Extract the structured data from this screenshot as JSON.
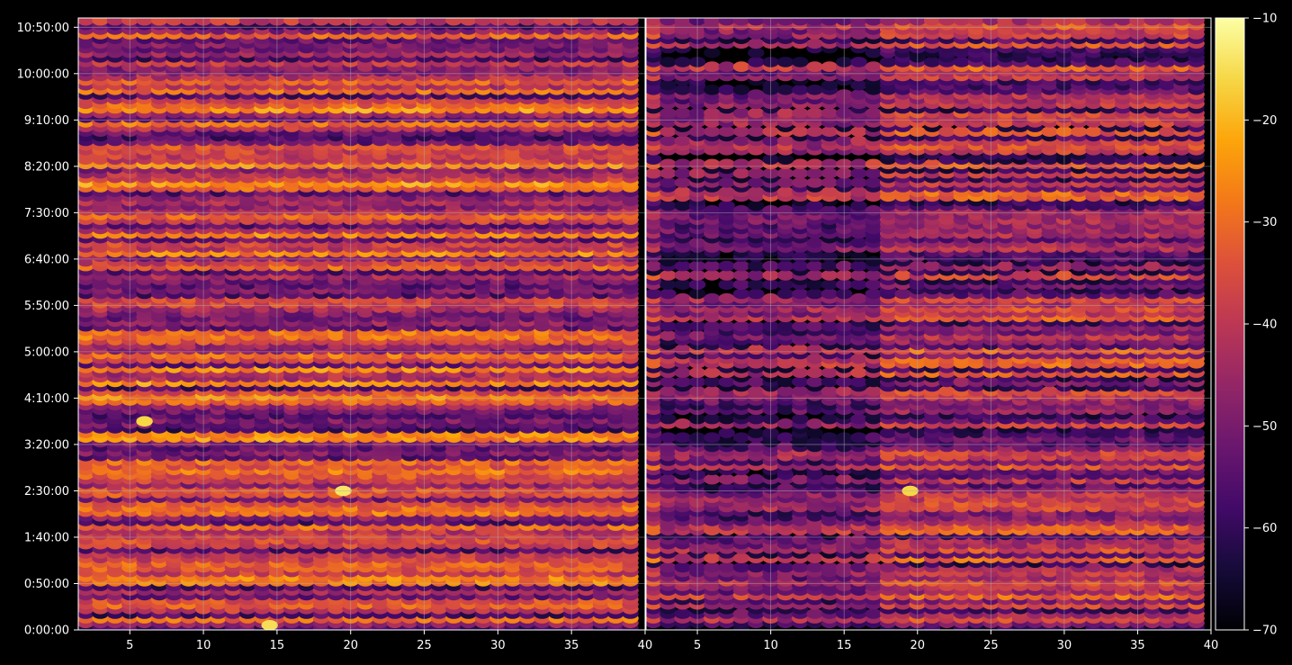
{
  "chart_data": {
    "type": "heatmap",
    "panels": [
      {
        "name": "",
        "xlim": [
          1.5,
          40
        ],
        "x_ticks": [
          5,
          10,
          15,
          20,
          25,
          30,
          35,
          40
        ],
        "x_tick_labels": [
          "5",
          "10",
          "15",
          "20",
          "25",
          "30",
          "35",
          "40"
        ],
        "x_columns": [
          2,
          3,
          4,
          5,
          6,
          7,
          8,
          9,
          10,
          11,
          12,
          13,
          14,
          15,
          16,
          17,
          18,
          19,
          20,
          21,
          22,
          23,
          24,
          25,
          26,
          27,
          28,
          29,
          30,
          31,
          32,
          33,
          34,
          35,
          36,
          37,
          38,
          39
        ],
        "y_unit": "minutes",
        "ylim": [
          0,
          660
        ],
        "y_ticks": [
          0,
          50,
          100,
          150,
          200,
          250,
          300,
          350,
          400,
          450,
          500,
          550,
          600,
          650
        ],
        "y_tick_labels": [
          "0:00:00",
          "0:50:00",
          "1:40:00",
          "2:30:00",
          "3:20:00",
          "4:10:00",
          "5:00:00",
          "5:50:00",
          "6:40:00",
          "7:30:00",
          "8:20:00",
          "9:10:00",
          "10:00:00",
          "10:50:00"
        ],
        "row_step_minutes": 5,
        "level_profile_note_removed": true,
        "peak_points": [
          {
            "x": 19.5,
            "y": 150,
            "value": -14
          },
          {
            "x": 14.5,
            "y": 5,
            "value": -15
          },
          {
            "x": 6,
            "y": 225,
            "value": -16
          }
        ]
      },
      {
        "name": "",
        "xlim": [
          1.5,
          40
        ],
        "x_ticks": [
          5,
          10,
          15,
          20,
          25,
          30,
          35,
          40
        ],
        "x_tick_labels": [
          "5",
          "10",
          "15",
          "20",
          "25",
          "30",
          "35",
          "40"
        ],
        "x_columns": [
          2,
          3,
          4,
          5,
          6,
          7,
          8,
          9,
          10,
          11,
          12,
          13,
          14,
          15,
          16,
          17,
          18,
          19,
          20,
          21,
          22,
          23,
          24,
          25,
          26,
          27,
          28,
          29,
          30,
          31,
          32,
          33,
          34,
          35,
          36,
          37,
          38,
          39
        ],
        "y_unit": "minutes",
        "ylim": [
          0,
          660
        ],
        "peak_points": [
          {
            "x": 19.5,
            "y": 150,
            "value": -16
          }
        ]
      }
    ],
    "colorbar": {
      "colormap": "inferno",
      "vmin": -70,
      "vmax": -10,
      "ticks": [
        -10,
        -20,
        -30,
        -40,
        -50,
        -60,
        -70
      ],
      "tick_labels": [
        "−10",
        "−20",
        "−30",
        "−40",
        "−50",
        "−60",
        "−70"
      ]
    },
    "grid": true,
    "title": "",
    "xlabel": "",
    "ylabel": ""
  },
  "colors": {
    "background": "#000000",
    "axes_frame": "#ffffff",
    "grid": "#b0b0b0",
    "text": "#ffffff"
  }
}
